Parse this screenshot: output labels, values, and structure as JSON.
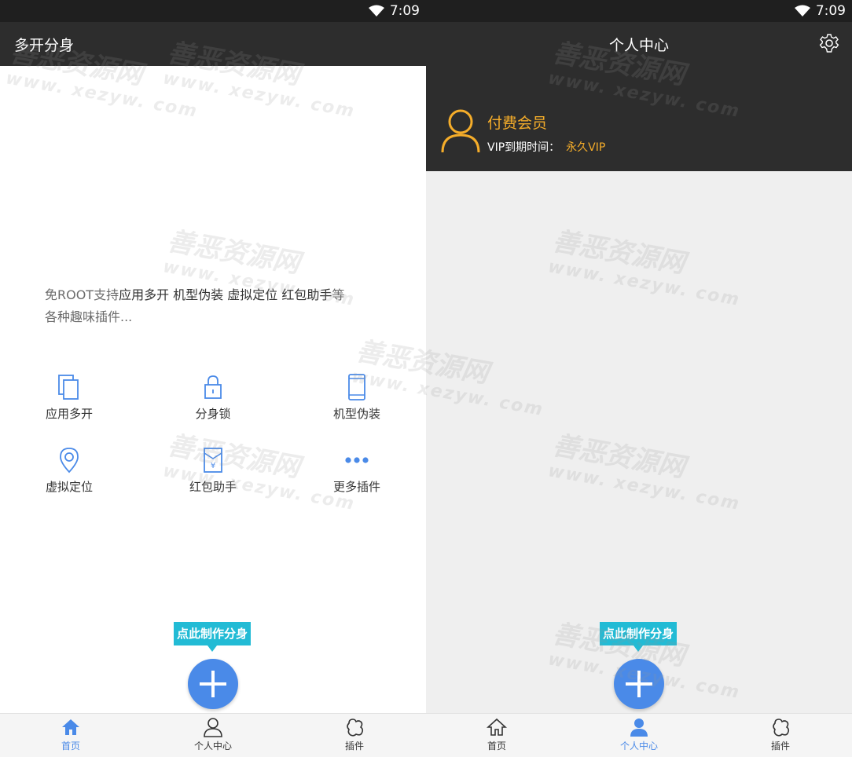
{
  "status": {
    "time": "7:09"
  },
  "left": {
    "title": "多开分身",
    "description": {
      "prefix": "免ROOT支持",
      "highlight": "应用多开 机型伪装 虚拟定位 红包助手",
      "suffix1": "等",
      "suffix2": "各种趣味插件..."
    },
    "features": [
      {
        "label": "应用多开",
        "icon": "multi-window-icon"
      },
      {
        "label": "分身锁",
        "icon": "lock-icon"
      },
      {
        "label": "机型伪装",
        "icon": "phone-icon"
      },
      {
        "label": "虚拟定位",
        "icon": "location-pin-icon"
      },
      {
        "label": "红包助手",
        "icon": "red-envelope-icon"
      },
      {
        "label": "更多插件",
        "icon": "more-dots-icon"
      }
    ]
  },
  "right": {
    "title": "个人中心",
    "vip": {
      "title": "付费会员",
      "expire_label": "VIP到期时间：",
      "expire_value": "永久VIP"
    }
  },
  "fab": {
    "tip": "点此制作分身"
  },
  "nav": {
    "items": [
      {
        "label": "首页",
        "icon": "home-icon"
      },
      {
        "label": "个人中心",
        "icon": "user-icon"
      },
      {
        "label": "插件",
        "icon": "plugin-icon"
      }
    ]
  },
  "watermark": {
    "cn": "善恶资源网",
    "en": "www. xezyw. com"
  },
  "colors": {
    "accent": "#4a8ae8",
    "vip": "#f5ad2a",
    "tip": "#22bbd5",
    "appbar": "#2d2d2d"
  }
}
